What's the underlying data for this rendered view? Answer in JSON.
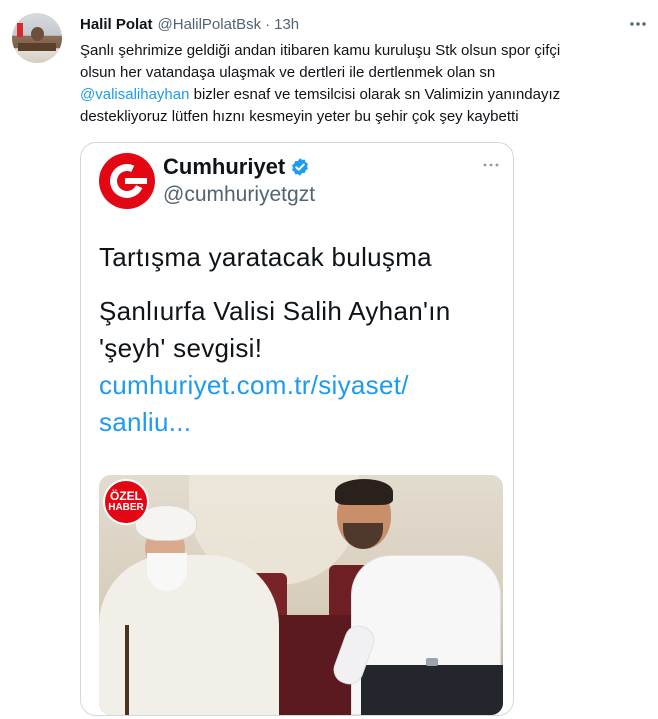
{
  "tweet": {
    "author_name": "Halil Polat",
    "author_handle": "@HalilPolatBsk",
    "separator": "·",
    "time": "13h",
    "body": {
      "line1": "Şanlı şehrimize geldiği andan itibaren kamu kuruluşu Stk olsun spor çifçi",
      "line2": "olsun her vatandaşa ulaşmak ve dertleri ile dertlenmek olan sn",
      "mention": "@valisalihayhan",
      "line3_rest": " bizler esnaf ve temsilcisi  olarak sn Valimizin yanındayız",
      "line4": "destekliyoruz lütfen hıznı kesmeyin yeter bu şehir çok şey kaybetti"
    }
  },
  "embedded": {
    "account_name": "Cumhuriyet",
    "account_handle": "@cumhuriyetgzt",
    "verified": true,
    "headline": "Tartışma yaratacak buluşma",
    "sub_line1": "Şanlıurfa Valisi Salih Ayhan'ın",
    "sub_line2": "'şeyh' sevgisi!",
    "link_line1": "cumhuriyet.com.tr/siyaset/",
    "link_line2": "sanliu...",
    "badge_line1": "ÖZEL",
    "badge_line2": "HABER"
  },
  "colors": {
    "accent": "#1d9bf0",
    "brand_red": "#e30613",
    "text_primary": "#0f1419",
    "text_secondary": "#536471",
    "border": "#cfd9de"
  },
  "icons": {
    "more": "more-horizontal-icon",
    "verified": "verified-badge-icon"
  }
}
